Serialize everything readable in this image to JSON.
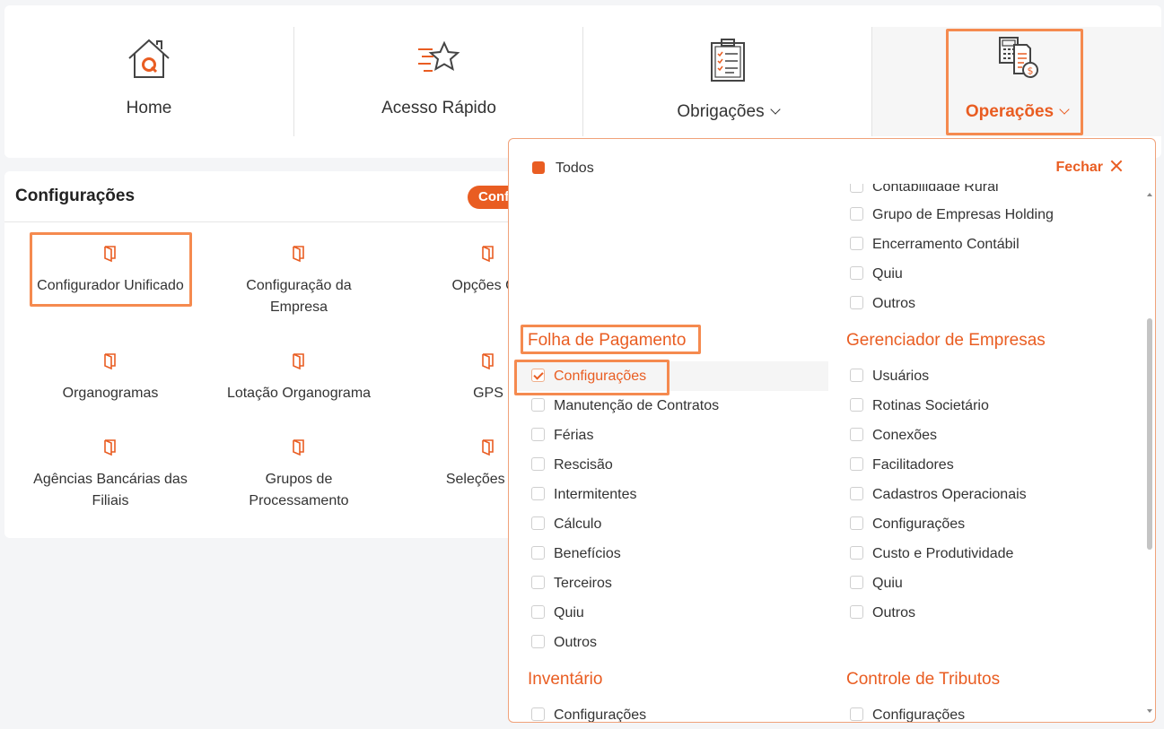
{
  "nav": {
    "items": [
      {
        "label": "Home",
        "icon": "house-icon"
      },
      {
        "label": "Acesso Rápido",
        "icon": "star-icon"
      },
      {
        "label": "Obrigações",
        "icon": "clipboard-icon"
      },
      {
        "label": "Operações",
        "icon": "calculator-money-icon"
      }
    ]
  },
  "config": {
    "title": "Configurações",
    "badge": "Configurações",
    "tiles": [
      {
        "label": "Configurador Unificado"
      },
      {
        "label": "Configuração da Empresa"
      },
      {
        "label": "Opções Ge"
      },
      {
        "label": "Organogramas"
      },
      {
        "label": "Lotação Organograma"
      },
      {
        "label": "GPS"
      },
      {
        "label": "Agências Bancárias das Filiais"
      },
      {
        "label": "Grupos de Processamento"
      },
      {
        "label": "Seleções Em"
      }
    ]
  },
  "panel": {
    "todos": "Todos",
    "close": "Fechar",
    "right_top": {
      "items": [
        "Contabilidade Rural",
        "Grupo de Empresas Holding",
        "Encerramento Contábil",
        "Quiu",
        "Outros"
      ]
    },
    "folha": {
      "title": "Folha de Pagamento",
      "items": [
        "Configurações",
        "Manutenção de Contratos",
        "Férias",
        "Rescisão",
        "Intermitentes",
        "Cálculo",
        "Benefícios",
        "Terceiros",
        "Quiu",
        "Outros"
      ]
    },
    "gerenciador": {
      "title": "Gerenciador de Empresas",
      "items": [
        "Usuários",
        "Rotinas Societário",
        "Conexões",
        "Facilitadores",
        "Cadastros Operacionais",
        "Configurações",
        "Custo e Produtividade",
        "Quiu",
        "Outros"
      ]
    },
    "inventario": {
      "title": "Inventário",
      "items": [
        "Configurações"
      ]
    },
    "tributos": {
      "title": "Controle de Tributos",
      "items": [
        "Configurações"
      ]
    }
  },
  "colors": {
    "accent": "#e95d22",
    "highlight": "#f58a4f"
  }
}
